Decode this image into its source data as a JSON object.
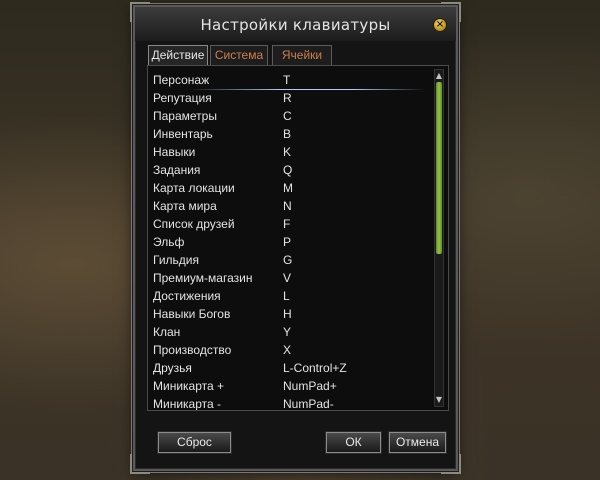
{
  "window": {
    "title": "Настройки клавиатуры",
    "close_glyph": "×"
  },
  "tabs": [
    {
      "label": "Действие",
      "active": true
    },
    {
      "label": "Система",
      "active": false
    },
    {
      "label": "Ячейки",
      "active": false
    }
  ],
  "bindings": [
    {
      "action": "Персонаж",
      "key": "T"
    },
    {
      "action": "Репутация",
      "key": "R"
    },
    {
      "action": "Параметры",
      "key": "C"
    },
    {
      "action": "Инвентарь",
      "key": "B"
    },
    {
      "action": "Навыки",
      "key": "K"
    },
    {
      "action": "Задания",
      "key": "Q"
    },
    {
      "action": "Карта локации",
      "key": "M"
    },
    {
      "action": "Карта мира",
      "key": "N"
    },
    {
      "action": "Список друзей",
      "key": "F"
    },
    {
      "action": "Эльф",
      "key": "P"
    },
    {
      "action": "Гильдия",
      "key": "G"
    },
    {
      "action": "Премиум-магазин",
      "key": "V"
    },
    {
      "action": "Достижения",
      "key": "L"
    },
    {
      "action": "Навыки Богов",
      "key": "H"
    },
    {
      "action": "Клан",
      "key": "Y"
    },
    {
      "action": "Производство",
      "key": "X"
    },
    {
      "action": "Друзья",
      "key": "L-Control+Z"
    },
    {
      "action": "Миникарта +",
      "key": "NumPad+"
    },
    {
      "action": "Миникарта -",
      "key": "NumPad-"
    }
  ],
  "buttons": {
    "reset": "Сброс",
    "ok": "ОК",
    "cancel": "Отмена"
  },
  "colors": {
    "tab_inactive_text": "#cc7f4e",
    "scroll_thumb": "#8ab43c",
    "selection_line": "#bcd4ff"
  }
}
